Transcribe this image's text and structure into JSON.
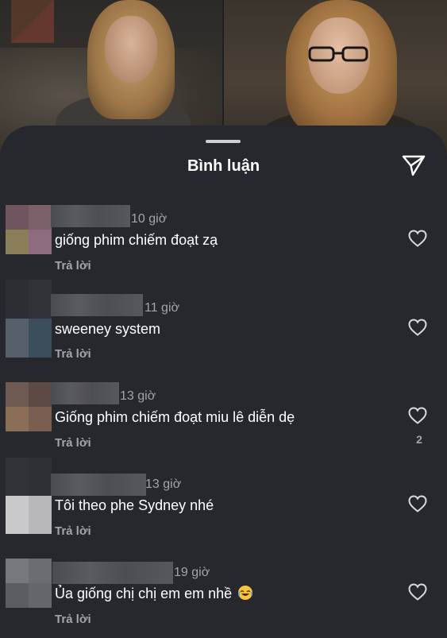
{
  "sheet": {
    "title": "Bình luận"
  },
  "comments": [
    {
      "time": "10 giờ",
      "text": "giống phim chiếm đoạt zạ",
      "reply": "Trả lời",
      "likes": ""
    },
    {
      "time": "11 giờ",
      "text": "sweeney system",
      "reply": "Trả lời",
      "likes": ""
    },
    {
      "time": "13 giờ",
      "text": "Giống phim chiếm đoạt miu lê diễn  dẹ",
      "reply": "Trả lời",
      "likes": "2"
    },
    {
      "time": "13 giờ",
      "text": "Tôi theo phe Sydney nhé",
      "reply": "Trả lời",
      "likes": ""
    },
    {
      "time": "19 giờ",
      "text": "Ủa giống chị chị em em nhề",
      "reply": "Trả lời",
      "likes": "",
      "emoji": "laughing-emoji"
    }
  ],
  "colors": {
    "sheet_bg": "#26282d",
    "text_primary": "#ffffff",
    "text_secondary": "#a2a5ab"
  },
  "icons": {
    "send": "paper-plane-icon",
    "like": "heart-outline-icon",
    "handle": "drag-handle"
  }
}
